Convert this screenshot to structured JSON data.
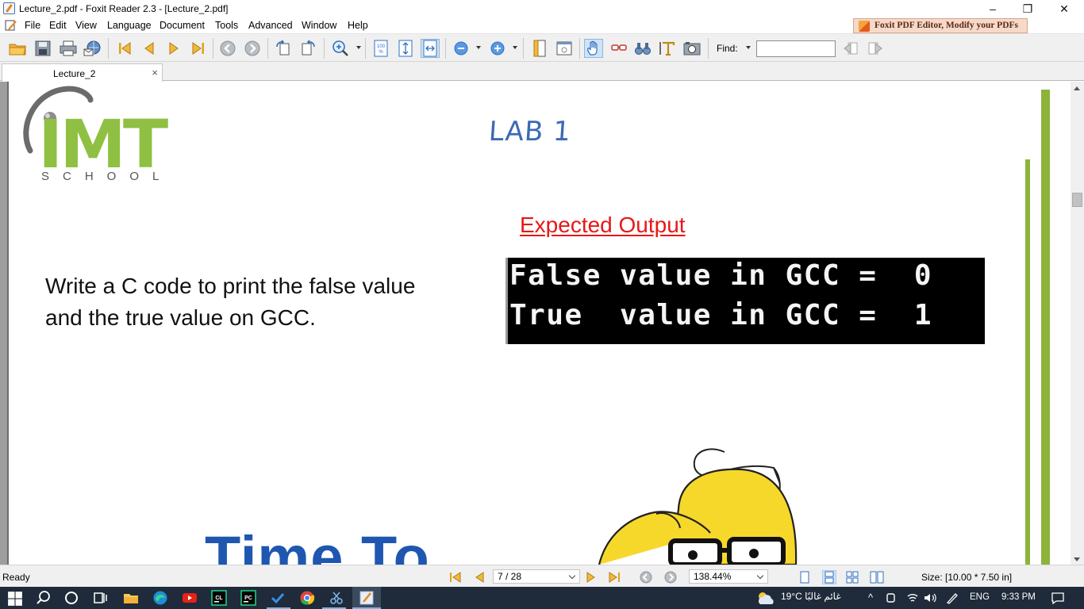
{
  "window": {
    "title": "Lecture_2.pdf - Foxit Reader 2.3 - [Lecture_2.pdf]",
    "minimize": "–",
    "restore": "❐",
    "close": "✕"
  },
  "menu": {
    "items": [
      "File",
      "Edit",
      "View",
      "Language",
      "Document",
      "Tools",
      "Advanced",
      "Window",
      "Help"
    ],
    "ad_banner": "Foxit PDF Editor, Modify your PDFs"
  },
  "toolbar": {
    "find_label": "Find:",
    "find_value": ""
  },
  "tabs": [
    {
      "label": "Lecture_2",
      "close": "×"
    }
  ],
  "page": {
    "logo_text": "IMT",
    "logo_subtext": "SCHOOL",
    "lab_title": "LAB 1",
    "expected_output_heading": "Expected Output",
    "terminal_lines": [
      "False value in GCC =  0",
      "True  value in GCC =  1"
    ],
    "task_text": "Write a C code to print the false value and the true value on GCC.",
    "time_to_text": "Time To"
  },
  "statusbar": {
    "status": "Ready",
    "page_indicator": "7 / 28",
    "zoom": "138.44%",
    "size": "Size: [10.00 * 7.50 in]"
  },
  "taskbar": {
    "weather": "19°C  غائم غالبًا",
    "language": "ENG",
    "time": "9:33 PM"
  },
  "colors": {
    "brand_green": "#8fc043",
    "lab_blue": "#3c6ab3",
    "expected_red": "#e61818",
    "time_to_blue": "#1f57b0",
    "taskbar_bg": "#1f2b3a"
  }
}
